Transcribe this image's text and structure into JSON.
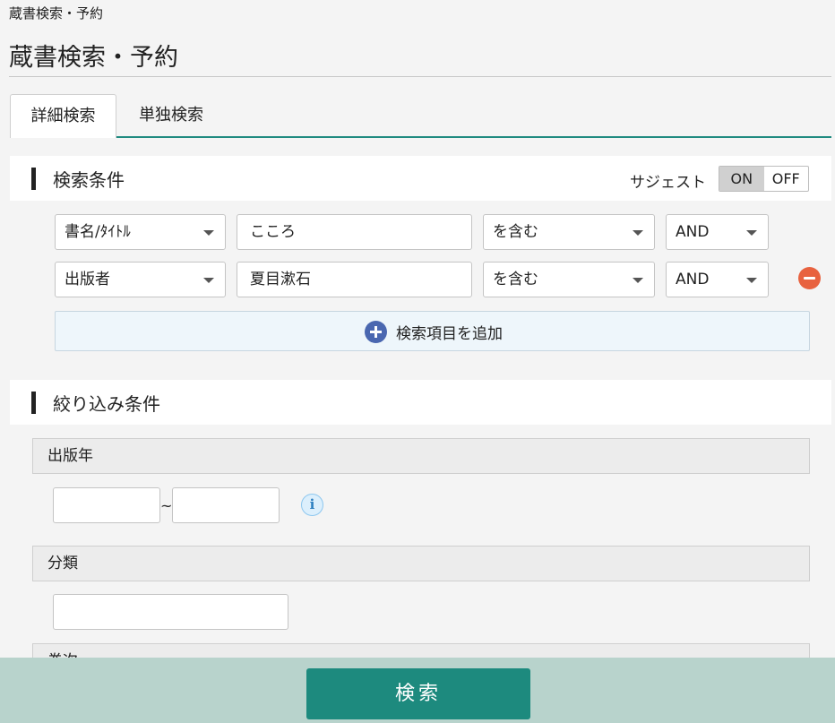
{
  "breadcrumb": "蔵書検索・予約",
  "page_title": "蔵書検索・予約",
  "tabs": [
    {
      "label": "詳細検索"
    },
    {
      "label": "単独検索"
    }
  ],
  "search_conditions": {
    "heading": "検索条件",
    "suggest_label": "サジェスト",
    "suggest_on": "ON",
    "suggest_off": "OFF",
    "rows": [
      {
        "field": "書名/ﾀｲﾄﾙ",
        "value": "こころ",
        "match": "を含む",
        "operator": "AND"
      },
      {
        "field": "出版者",
        "value": "夏目漱石",
        "match": "を含む",
        "operator": "AND"
      }
    ],
    "add_label": "検索項目を追加"
  },
  "filters": {
    "heading": "絞り込み条件",
    "year_label": "出版年",
    "year_from": "",
    "year_to": "",
    "tilde": "~",
    "info_icon": "i",
    "category_label": "分類",
    "category_value": "",
    "third_label": "巻次"
  },
  "footer": {
    "search_label": "検索"
  }
}
